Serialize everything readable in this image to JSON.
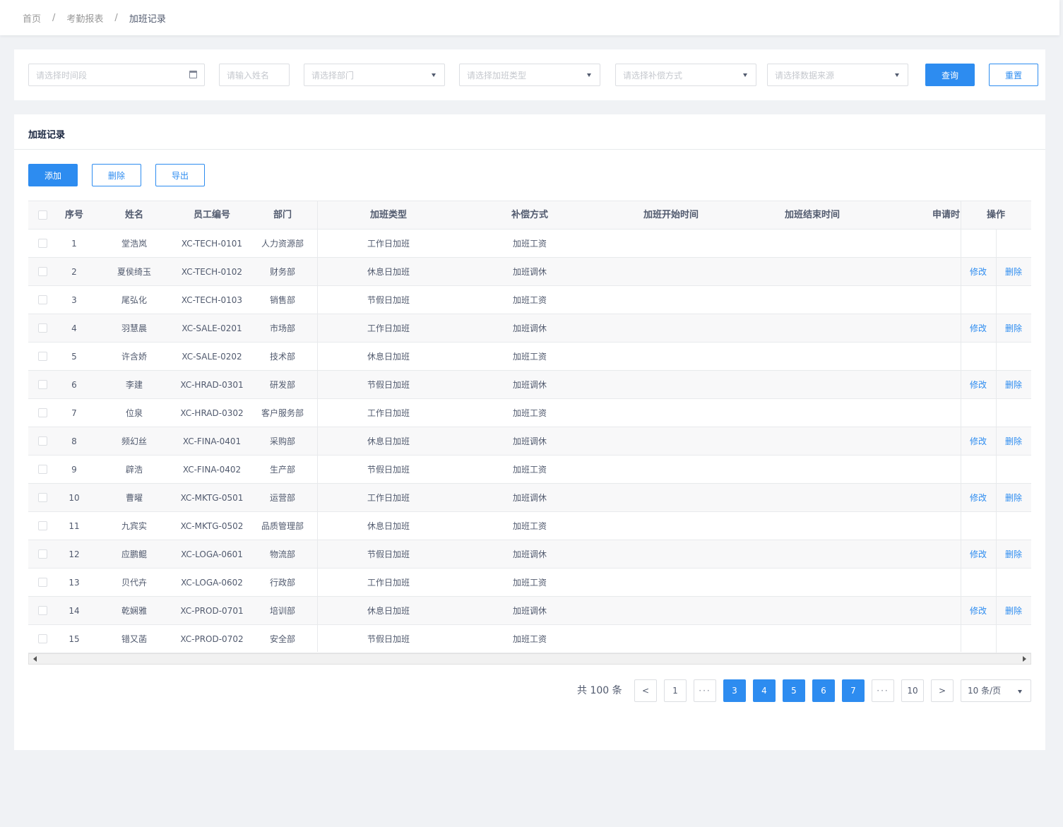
{
  "breadcrumb": [
    "首页",
    "考勤报表",
    "加班记录"
  ],
  "filters": {
    "date_placeholder": "请选择时间段",
    "name_placeholder": "请输入姓名",
    "dept_placeholder": "请选择部门",
    "type_placeholder": "请选择加班类型",
    "comp_placeholder": "请选择补偿方式",
    "source_placeholder": "请选择数据来源",
    "query_label": "查询",
    "reset_label": "重置"
  },
  "card": {
    "title": "加班记录",
    "add_label": "添加",
    "delete_label": "删除",
    "export_label": "导出"
  },
  "table": {
    "headers": [
      "序号",
      "姓名",
      "员工编号",
      "部门",
      "加班类型",
      "补偿方式",
      "加班开始时间",
      "加班结束时间",
      "申请时",
      "操作"
    ],
    "edit_label": "修改",
    "del_label": "删除",
    "rows": [
      {
        "no": "1",
        "name": "堂浩岚",
        "id": "XC-TECH-0101",
        "dept": "人力资源部",
        "type": "工作日加班",
        "comp": "加班工资",
        "ops": false
      },
      {
        "no": "2",
        "name": "夏侯绮玉",
        "id": "XC-TECH-0102",
        "dept": "财务部",
        "type": "休息日加班",
        "comp": "加班调休",
        "ops": true
      },
      {
        "no": "3",
        "name": "尾弘化",
        "id": "XC-TECH-0103",
        "dept": "销售部",
        "type": "节假日加班",
        "comp": "加班工资",
        "ops": false
      },
      {
        "no": "4",
        "name": "羽慧晨",
        "id": "XC-SALE-0201",
        "dept": "市场部",
        "type": "工作日加班",
        "comp": "加班调休",
        "ops": true
      },
      {
        "no": "5",
        "name": "许含娇",
        "id": "XC-SALE-0202",
        "dept": "技术部",
        "type": "休息日加班",
        "comp": "加班工资",
        "ops": false
      },
      {
        "no": "6",
        "name": "李建",
        "id": "XC-HRAD-0301",
        "dept": "研发部",
        "type": "节假日加班",
        "comp": "加班调休",
        "ops": true
      },
      {
        "no": "7",
        "name": "位泉",
        "id": "XC-HRAD-0302",
        "dept": "客户服务部",
        "type": "工作日加班",
        "comp": "加班工资",
        "ops": false
      },
      {
        "no": "8",
        "name": "频幻丝",
        "id": "XC-FINA-0401",
        "dept": "采购部",
        "type": "休息日加班",
        "comp": "加班调休",
        "ops": true
      },
      {
        "no": "9",
        "name": "辟浩",
        "id": "XC-FINA-0402",
        "dept": "生产部",
        "type": "节假日加班",
        "comp": "加班工资",
        "ops": false
      },
      {
        "no": "10",
        "name": "曹曜",
        "id": "XC-MKTG-0501",
        "dept": "运营部",
        "type": "工作日加班",
        "comp": "加班调休",
        "ops": true
      },
      {
        "no": "11",
        "name": "九宾实",
        "id": "XC-MKTG-0502",
        "dept": "品质管理部",
        "type": "休息日加班",
        "comp": "加班工资",
        "ops": false
      },
      {
        "no": "12",
        "name": "应鹏鲲",
        "id": "XC-LOGA-0601",
        "dept": "物流部",
        "type": "节假日加班",
        "comp": "加班调休",
        "ops": true
      },
      {
        "no": "13",
        "name": "贝代卉",
        "id": "XC-LOGA-0602",
        "dept": "行政部",
        "type": "工作日加班",
        "comp": "加班工资",
        "ops": false
      },
      {
        "no": "14",
        "name": "乾娴雅",
        "id": "XC-PROD-0701",
        "dept": "培训部",
        "type": "休息日加班",
        "comp": "加班调休",
        "ops": true
      },
      {
        "no": "15",
        "name": "错又菡",
        "id": "XC-PROD-0702",
        "dept": "安全部",
        "type": "节假日加班",
        "comp": "加班工资",
        "ops": false
      }
    ]
  },
  "pagination": {
    "total_text": "共 100 条",
    "prev": "<",
    "next": ">",
    "pages": [
      "1",
      "···",
      "3",
      "4",
      "5",
      "6",
      "7",
      "···",
      "10"
    ],
    "active_pages": [
      "3",
      "4",
      "5",
      "6",
      "7"
    ],
    "page_size": "10 条/页"
  },
  "colors": {
    "primary": "#2d8cf0",
    "background": "#f0f2f5"
  }
}
